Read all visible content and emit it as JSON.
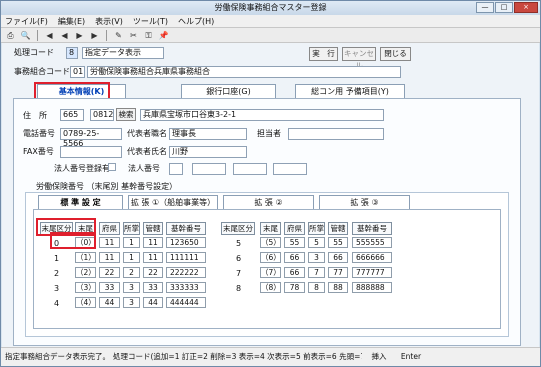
{
  "window": {
    "title": "労働保険事務組合マスター登録",
    "minimize": "—",
    "maximize": "□",
    "close": "×"
  },
  "menu": [
    "ファイル(F)",
    "編集(E)",
    "表示(V)",
    "ツール(T)",
    "ヘルプ(H)"
  ],
  "toolbar": [
    "⎙",
    "🔍",
    "◀",
    "◀",
    "▶",
    "▶",
    "✎",
    "✂",
    "⚿",
    "📌"
  ],
  "header": {
    "process_label": "処理コード",
    "process_code": "8",
    "process_value": "指定データ表示",
    "execute": "実　行",
    "cancel": "キャンセル",
    "close": "閉じる",
    "union_label": "事務組合コード",
    "union_code": "01",
    "union_name": "労働保険事務組合兵庫県事務組合"
  },
  "tabs": [
    "基本情報(K)",
    "銀行口座(G)",
    "総コン用 予備項目(Y)"
  ],
  "basic": {
    "address_label": "住　所",
    "zip1": "665",
    "zip2": "0812",
    "search": "検索",
    "address": "兵庫県宝塚市口谷東3-2-1",
    "phone_label": "電話番号",
    "phone": "0789-25-5566",
    "rep_title_label": "代表者職名",
    "rep_title": "理事長",
    "contact_label": "担当者",
    "fax_label": "FAX番号",
    "rep_name_label": "代表者氏名",
    "rep_name": "川野",
    "corp_flag_label": "法人番号登録有",
    "corp_number_label": "法人番号"
  },
  "insurance": {
    "section_label": "労働保険番号 （末尾別 基幹番号設定）",
    "tabs": [
      "標 準 設 定",
      "拡 張 ①（船舶事業等）",
      "拡 張 ②",
      "拡 張 ③"
    ],
    "headers": [
      "末尾区分",
      "末尾",
      "府県",
      "所掌",
      "管轄",
      "基幹番号"
    ],
    "left_rows": [
      [
        "0",
        "（0）",
        "11",
        "1",
        "11",
        "123650"
      ],
      [
        "1",
        "（1）",
        "11",
        "1",
        "11",
        "111111"
      ],
      [
        "2",
        "（2）",
        "22",
        "2",
        "22",
        "222222"
      ],
      [
        "3",
        "（3）",
        "33",
        "3",
        "33",
        "333333"
      ],
      [
        "4",
        "（4）",
        "44",
        "3",
        "44",
        "444444"
      ]
    ],
    "right_rows": [
      [
        "5",
        "（5）",
        "55",
        "5",
        "55",
        "555555"
      ],
      [
        "6",
        "（6）",
        "66",
        "3",
        "66",
        "666666"
      ],
      [
        "7",
        "（7）",
        "66",
        "7",
        "77",
        "777777"
      ],
      [
        "8",
        "（8）",
        "78",
        "8",
        "88",
        "888888"
      ]
    ]
  },
  "status": {
    "message": "指定事務組合データ表示完了。",
    "help": "処理コード(追加=1 訂正=2 削除=3 表示=4 次表示=5 前表示=6 先頭=7 最終=8)",
    "mode": "挿入",
    "key": "Enter"
  }
}
